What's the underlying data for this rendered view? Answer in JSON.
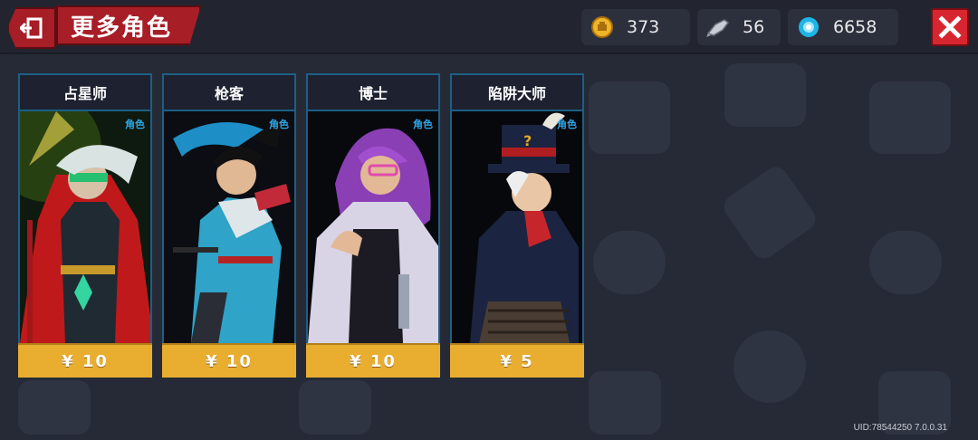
{
  "header": {
    "title": "更多角色"
  },
  "currencies": [
    {
      "icon": "gold-coin-icon",
      "value": "373"
    },
    {
      "icon": "fish-icon",
      "value": "56"
    },
    {
      "icon": "gem-icon",
      "value": "6658"
    }
  ],
  "cards": [
    {
      "name": "占星师",
      "tag": "角色",
      "price": "¥ 10"
    },
    {
      "name": "枪客",
      "tag": "角色",
      "price": "¥ 10"
    },
    {
      "name": "博士",
      "tag": "角色",
      "price": "¥ 10"
    },
    {
      "name": "陷阱大师",
      "tag": "角色",
      "price": "¥ 5"
    }
  ],
  "footer": {
    "uid": "UID:78544250 7.0.0.31"
  },
  "colors": {
    "accent_red": "#a71e27",
    "price_gold": "#e9ae2f",
    "card_border": "#1c5f86"
  }
}
